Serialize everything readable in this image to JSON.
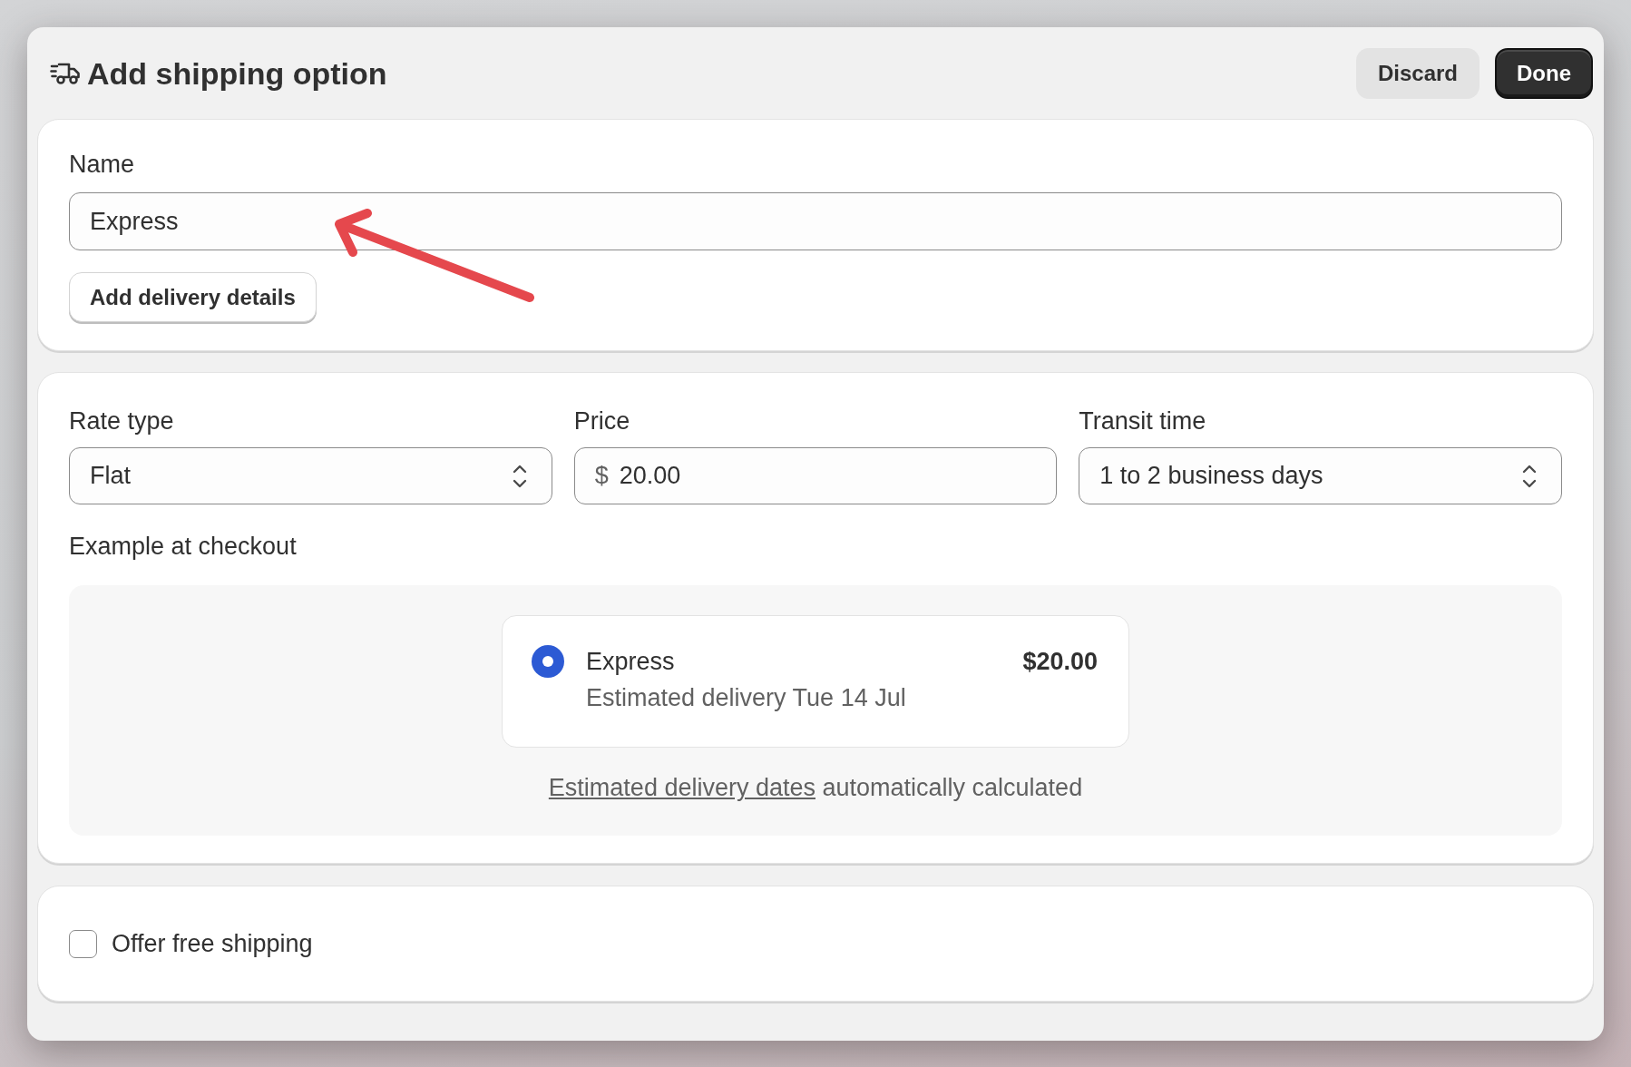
{
  "window": {
    "title": "Add shipping option"
  },
  "header_buttons": [
    {
      "label": "Discard",
      "kind": "secondary"
    },
    {
      "label": "Done",
      "kind": "primary"
    }
  ],
  "name_section": {
    "label": "Name",
    "value": "Express",
    "button": "Add delivery details"
  },
  "rate_section": {
    "fields": [
      {
        "label": "Rate type",
        "kind": "select",
        "value": "Flat"
      },
      {
        "label": "Price",
        "kind": "currency",
        "prefix": "$",
        "value": "20.00"
      },
      {
        "label": "Transit time",
        "kind": "select",
        "value": "1 to 2 business days"
      }
    ]
  },
  "checkout_example": {
    "label": "Example at checkout",
    "option": {
      "name": "Express",
      "selected": true,
      "price": "$20.00",
      "detail": "Estimated delivery Tue 14 Jul"
    },
    "note_link": "Estimated delivery dates",
    "note_text": "automatically calculated"
  },
  "free_shipping": {
    "label": "Offer free shipping",
    "checked": false
  }
}
